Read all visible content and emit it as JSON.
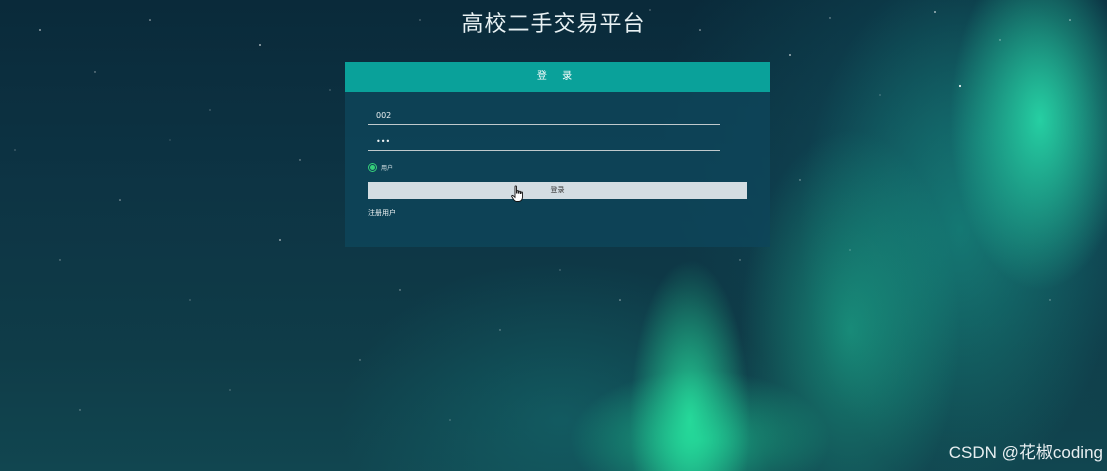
{
  "page": {
    "title": "高校二手交易平台"
  },
  "login_card": {
    "header": "登 录",
    "username_value": "002",
    "password_value": "•••",
    "role_label": "用户",
    "login_button": "登录",
    "register_link": "注册用户"
  },
  "icons": {
    "cursor": "hand-pointer-icon",
    "radio": "radio-selected-icon"
  },
  "colors": {
    "header_bg": "#0aa19a",
    "radio_accent": "#36d07a",
    "button_bg": "#d3dde2"
  },
  "watermark": "CSDN @花椒coding"
}
